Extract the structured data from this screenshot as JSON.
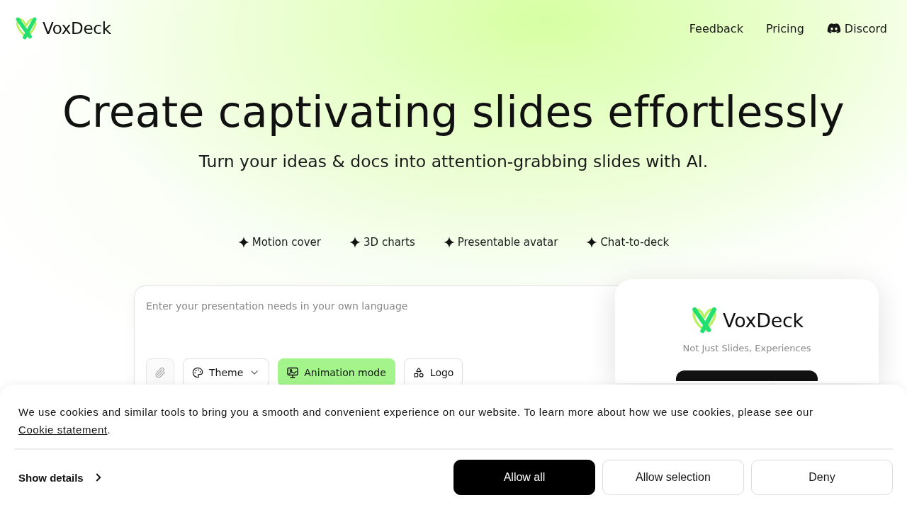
{
  "header": {
    "brand": "VoxDeck",
    "nav": [
      {
        "kind": "text",
        "label": "Feedback"
      },
      {
        "kind": "text",
        "label": "Pricing"
      },
      {
        "kind": "icon",
        "label": "Discord"
      }
    ]
  },
  "hero": {
    "title": "Create captivating slides effortlessly",
    "subtitle": "Turn your ideas & docs into attention-grabbing slides with AI."
  },
  "features": [
    "Motion cover",
    "3D charts",
    "Presentable avatar",
    "Chat-to-deck"
  ],
  "prompt": {
    "placeholder": "Enter your presentation needs in your own language",
    "toolbar": [
      {
        "kind": "dropdown",
        "label": "Theme",
        "on": false
      },
      {
        "kind": "toggle",
        "label": "Animation mode",
        "on": true
      },
      {
        "kind": "button",
        "label": "Logo",
        "on": false
      }
    ]
  },
  "promo_card": {
    "brand": "VoxDeck",
    "tagline": "Not Just Slides, Experiences"
  },
  "cookie_banner": {
    "text": "We use cookies and similar tools to bring you a smooth and convenient experience on our website. To learn more about how we use cookies, please see our",
    "link": "Cookie statement",
    "text_end": ".",
    "details": "Show details",
    "buttons": [
      {
        "kind": "primary",
        "label": "Allow all"
      },
      {
        "kind": "secondary",
        "label": "Allow selection"
      },
      {
        "kind": "secondary",
        "label": "Deny"
      }
    ]
  }
}
